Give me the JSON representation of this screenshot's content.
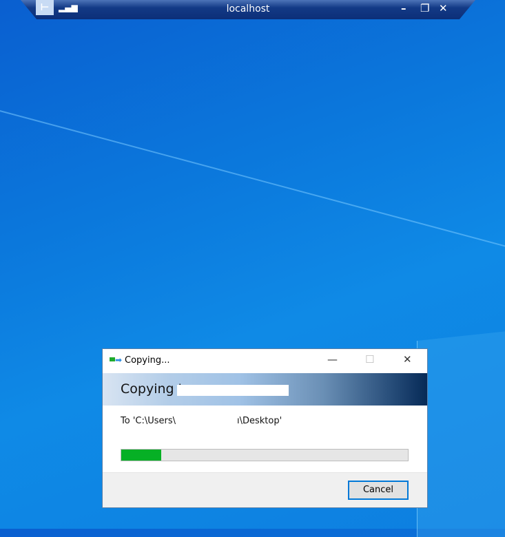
{
  "remote_bar": {
    "title": "localhost",
    "minimize": "–",
    "restore": "❐",
    "close": "✕",
    "pin": "⊢",
    "signal": "▂▄▆"
  },
  "dialog": {
    "title": "Copying...",
    "minimize": "—",
    "maximize": "☐",
    "close": "✕",
    "heading": "Copying '",
    "destination_prefix": "To 'C:\\Users\\",
    "destination_suffix": "ı\\Desktop'",
    "progress_percent": 14,
    "cancel_label": "Cancel",
    "progress_color": "#06b025"
  }
}
